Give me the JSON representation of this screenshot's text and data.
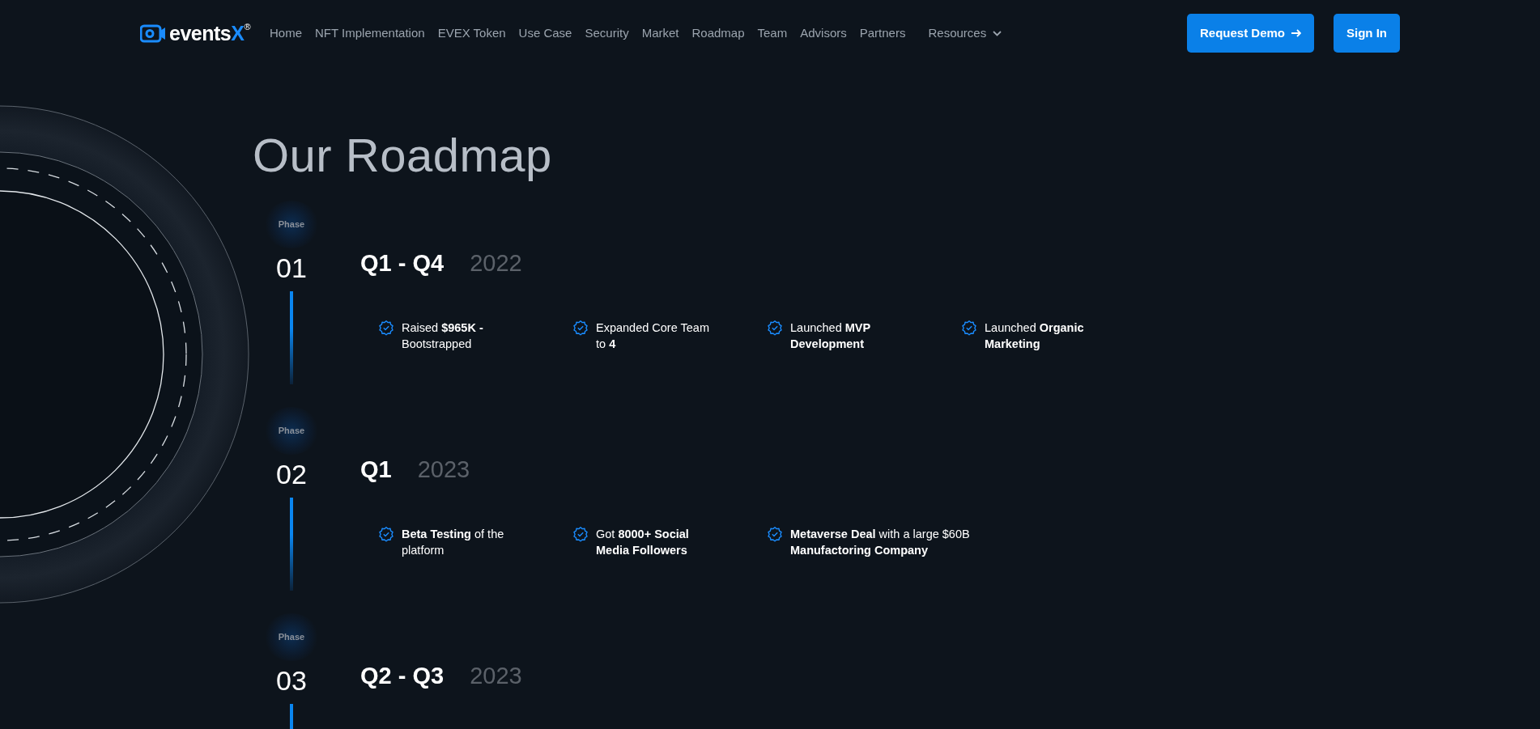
{
  "logo": {
    "text": "events",
    "accent": "X",
    "mark": "®"
  },
  "nav": [
    {
      "label": "Home",
      "kind": "link"
    },
    {
      "label": "NFT Implementation",
      "kind": "link"
    },
    {
      "label": "EVEX Token",
      "kind": "link"
    },
    {
      "label": "Use Case",
      "kind": "link"
    },
    {
      "label": "Security",
      "kind": "link"
    },
    {
      "label": "Market",
      "kind": "link"
    },
    {
      "label": "Roadmap",
      "kind": "link"
    },
    {
      "label": "Team",
      "kind": "link"
    },
    {
      "label": "Advisors",
      "kind": "link"
    },
    {
      "label": "Partners",
      "kind": "link"
    },
    {
      "label": "Resources",
      "kind": "dropdown"
    }
  ],
  "actions": [
    {
      "label": "Request Demo",
      "arrow": true
    },
    {
      "label": "Sign In",
      "arrow": false
    }
  ],
  "title": "Our Roadmap",
  "phases": [
    {
      "label": "Phase",
      "number": "01",
      "quarter": "Q1 - Q4",
      "year": "2022",
      "items": [
        {
          "lines": [
            "Raised **$965K -**",
            "Bootstrapped"
          ]
        },
        {
          "lines": [
            "Expanded Core Team",
            "to **4**"
          ]
        },
        {
          "lines": [
            "Launched **MVP**",
            "**Development**"
          ]
        },
        {
          "lines": [
            "Launched **Organic**",
            "**Marketing**"
          ]
        }
      ]
    },
    {
      "label": "Phase",
      "number": "02",
      "quarter": "Q1",
      "year": "2023",
      "items": [
        {
          "lines": [
            "**Beta Testing** of the",
            "platform"
          ]
        },
        {
          "lines": [
            "Got **8000+ Social**",
            "**Media Followers**"
          ]
        },
        {
          "lines": [
            "**Metaverse Deal** with a large $60B",
            "**Manufactoring Company**"
          ]
        }
      ]
    },
    {
      "label": "Phase",
      "number": "03",
      "quarter": "Q2 - Q3",
      "year": "2023"
    }
  ]
}
